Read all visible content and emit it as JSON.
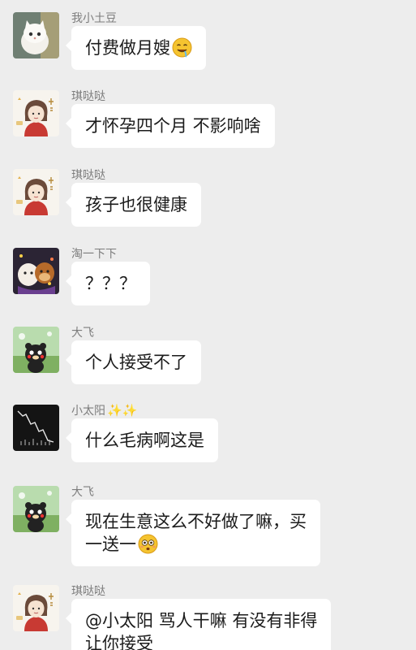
{
  "messages": [
    {
      "sender": "我小土豆",
      "text": "付费做月嫂",
      "emoji": "drooling-face-emoji"
    },
    {
      "sender": "琪哒哒",
      "text": "才怀孕四个月 不影响啥"
    },
    {
      "sender": "琪哒哒",
      "text": "孩子也很健康"
    },
    {
      "sender": "淘一下下",
      "text": "？？？"
    },
    {
      "sender": "大飞",
      "text": "个人接受不了"
    },
    {
      "sender": "小太阳",
      "sender_suffix": "✨✨",
      "text": "什么毛病啊这是"
    },
    {
      "sender": "大飞",
      "text_line1": "现在生意这么不好做了嘛，买",
      "text_line2": "一送一",
      "emoji": "flushed-face-emoji"
    },
    {
      "sender": "琪哒哒",
      "text_line1": "@小太阳 骂人干嘛 有没有非得",
      "text_line2": "让你接受"
    }
  ],
  "avatars": {
    "avatar_1": "white-cat-avatar",
    "avatar_2": "cartoon-girl-avatar",
    "avatar_3": "cartoon-girl-avatar",
    "avatar_4": "cartoon-characters-avatar",
    "avatar_5": "kumamon-bear-avatar",
    "avatar_6": "dark-chart-avatar",
    "avatar_7": "kumamon-bear-avatar",
    "avatar_8": "cartoon-girl-avatar"
  },
  "colors": {
    "background": "#ededed",
    "bubble": "#ffffff",
    "sender_name": "#7d7d7d",
    "text": "#1b1b1b"
  }
}
